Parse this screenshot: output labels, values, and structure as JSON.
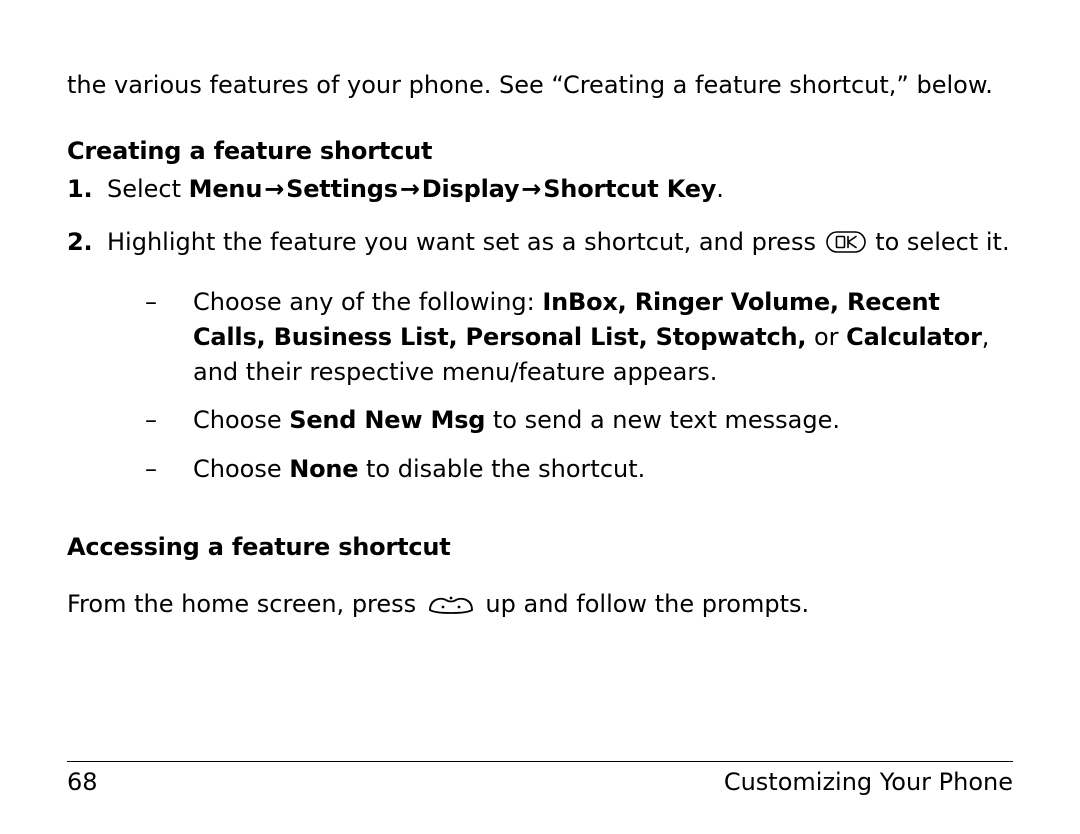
{
  "intro": "the various features of your phone. See “Creating a feature shortcut,” below.",
  "heading1": "Creating a feature shortcut",
  "step1": {
    "num": "1.",
    "lead": "Select ",
    "path": [
      "Menu",
      "Settings",
      "Display",
      "Shortcut Key"
    ],
    "tail": ".",
    "arrow": "→"
  },
  "step2": {
    "num": "2.",
    "pre": "Highlight the feature you want set as a shortcut, and press ",
    "post": " to select it.",
    "ok_label": "OK"
  },
  "bullets": {
    "dash": "–",
    "b1": {
      "pre": "Choose any of the following: ",
      "bold1": "InBox, Ringer Volume, Recent Calls, Business List, Personal List, Stopwatch,",
      "mid": " or ",
      "bold2": "Calculator",
      "post": ", and their respective menu/feature appears."
    },
    "b2": {
      "pre": "Choose ",
      "bold": "Send New Msg",
      "post": " to send a new text message."
    },
    "b3": {
      "pre": "Choose ",
      "bold": "None",
      "post": " to disable the shortcut."
    }
  },
  "heading2": "Accessing a feature shortcut",
  "access": {
    "pre": "From the home screen, press ",
    "post": " up and follow the prompts."
  },
  "footer": {
    "page_num": "68",
    "section": "Customizing Your Phone"
  }
}
